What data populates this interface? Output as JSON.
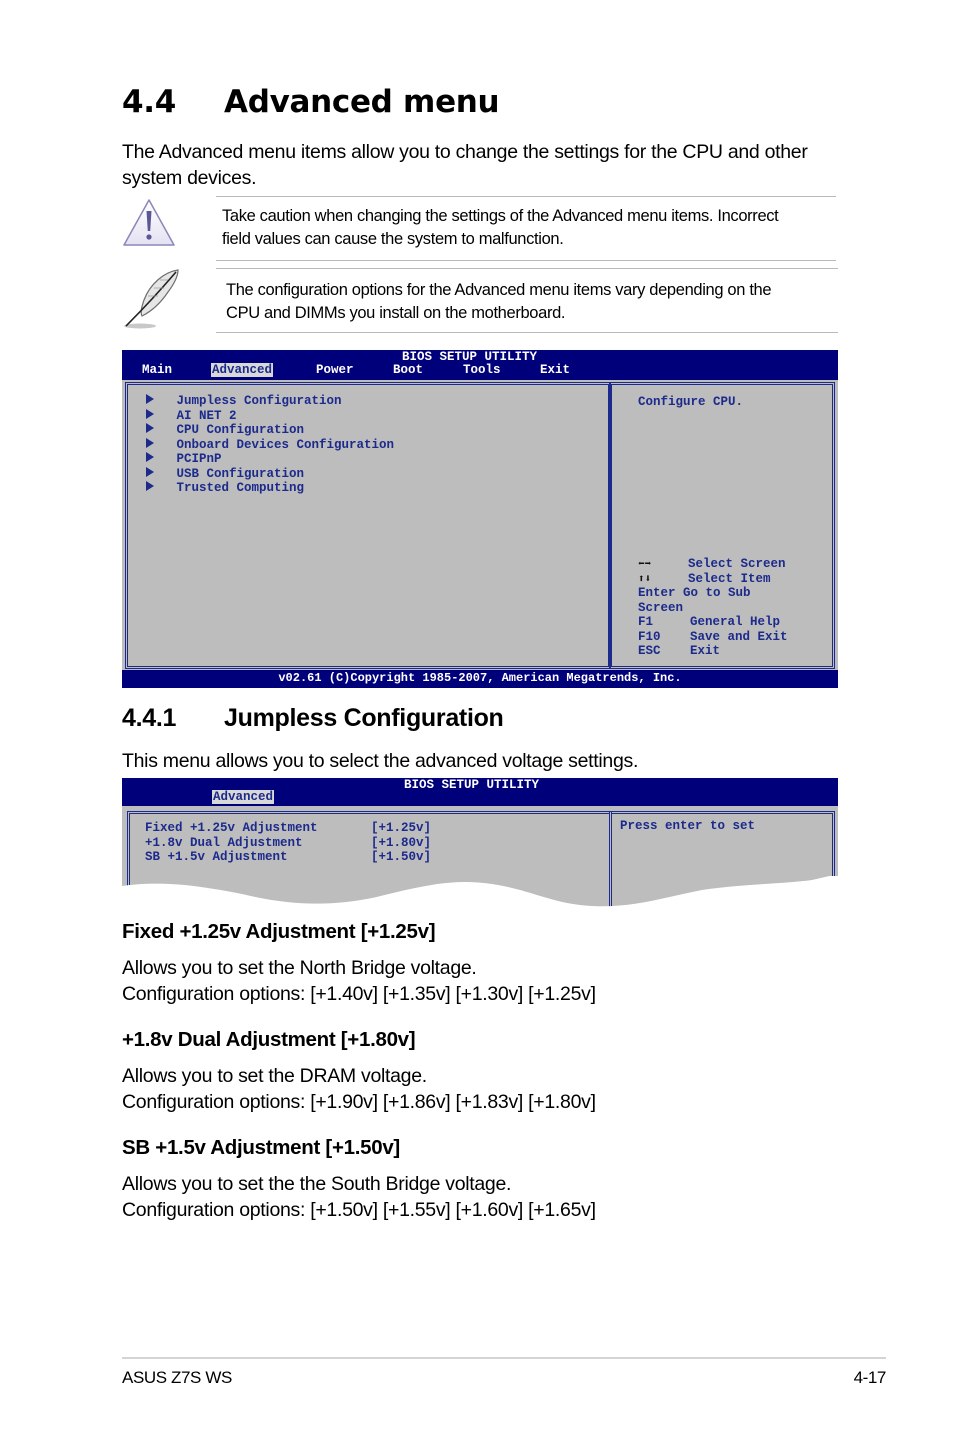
{
  "section": {
    "number": "4.4",
    "title": "Advanced menu",
    "intro": "The Advanced menu items allow you to change the settings for the CPU and other system devices."
  },
  "notes": {
    "caution": {
      "icon": "warning-triangle-icon",
      "line1": "Take caution when changing the settings of the Advanced menu items. Incorrect",
      "line2": "field values can cause the system to malfunction."
    },
    "info": {
      "icon": "feather-pen-icon",
      "line1": "The configuration options for the Advanced menu items vary depending on the",
      "line2": "CPU and DIMMs you install on the motherboard."
    }
  },
  "bios_main": {
    "title": "BIOS SETUP UTILITY",
    "tabs": [
      "Main",
      "Advanced",
      "Power",
      "Boot",
      "Tools",
      "Exit"
    ],
    "active_tab": "Advanced",
    "items": [
      "Jumpless Configuration",
      "AI NET 2",
      "CPU Configuration",
      "Onboard Devices Configuration",
      "PCIPnP",
      "USB Configuration",
      "Trusted Computing"
    ],
    "help_text": "Configure CPU.",
    "keys": [
      {
        "key_icon": "left-right-arrows-icon",
        "key": "",
        "action": "Select Screen"
      },
      {
        "key_icon": "up-down-arrows-icon",
        "key": "",
        "action": "Select Item"
      },
      {
        "key": "Enter",
        "action": "Go to Sub"
      },
      {
        "key": "Screen",
        "action": ""
      },
      {
        "key": "F1",
        "action": "General Help"
      },
      {
        "key": "F10",
        "action": "Save and Exit"
      },
      {
        "key": "ESC",
        "action": "Exit"
      }
    ],
    "footer": "v02.61 (C)Copyright 1985-2007, American Megatrends, Inc."
  },
  "subsection": {
    "number": "4.4.1",
    "title": "Jumpless Configuration",
    "intro": "This menu allows you to select the advanced voltage settings."
  },
  "bios_jumpless": {
    "title": "BIOS SETUP UTILITY",
    "active_tab": "Advanced",
    "rows": [
      {
        "label": "Fixed +1.25v Adjustment",
        "value": "[+1.25v]"
      },
      {
        "label": "+1.8v Dual Adjustment",
        "value": "[+1.80v]"
      },
      {
        "label": "SB +1.5v Adjustment",
        "value": "[+1.50v]"
      }
    ],
    "help_text": "Press enter to set"
  },
  "settings": [
    {
      "heading": "Fixed +1.25v Adjustment [+1.25v]",
      "desc": "Allows you to set the North Bridge voltage.",
      "options": "Configuration options: [+1.40v] [+1.35v] [+1.30v] [+1.25v]"
    },
    {
      "heading": "+1.8v Dual Adjustment [+1.80v]",
      "desc": "Allows you to set the DRAM voltage.",
      "options": "Configuration options: [+1.90v] [+1.86v] [+1.83v] [+1.80v]"
    },
    {
      "heading": "SB +1.5v Adjustment [+1.50v]",
      "desc": "Allows you to set the the South Bridge voltage.",
      "options": "Configuration options: [+1.50v] [+1.55v] [+1.60v] [+1.65v]"
    }
  ],
  "footer": {
    "product": "ASUS Z7S WS",
    "page": "4-17"
  }
}
